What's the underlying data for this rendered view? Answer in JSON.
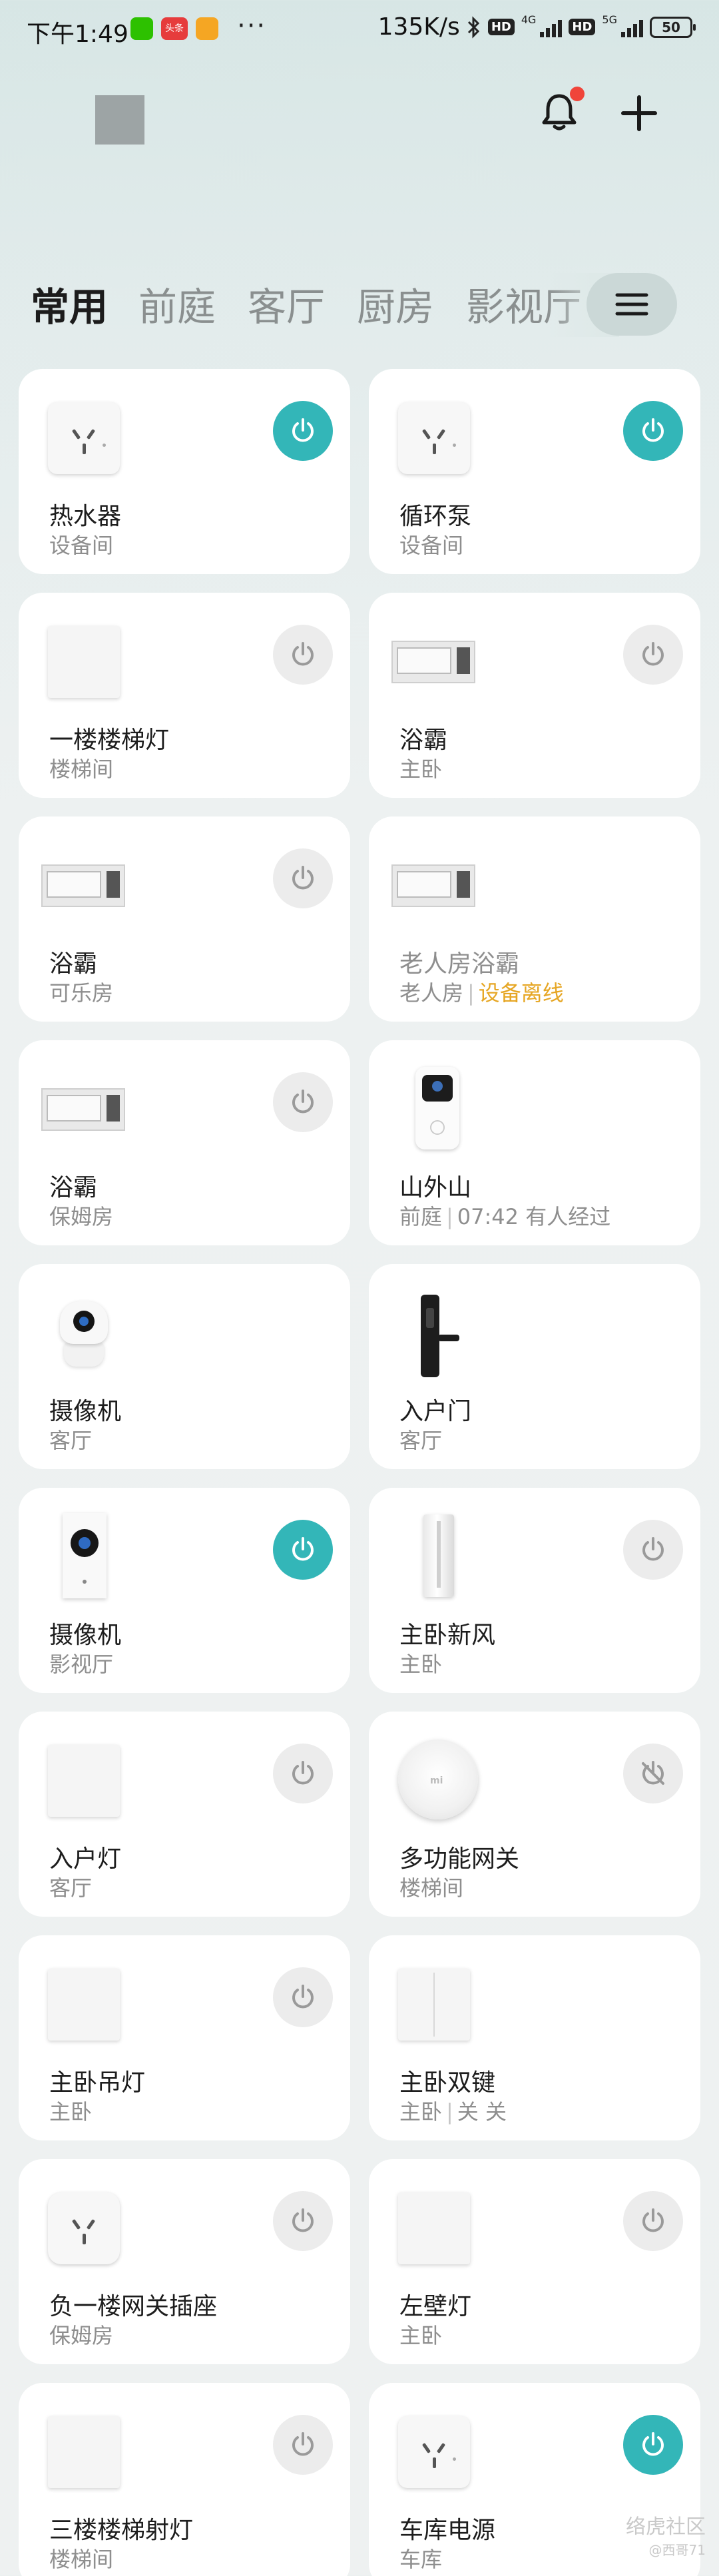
{
  "status_bar": {
    "time": "下午1:49",
    "app_badge": "头条",
    "more": "···",
    "net_speed": "135K/s",
    "hd1": "HD",
    "net1": "4G",
    "hd2": "HD",
    "net2": "5G",
    "battery": "50"
  },
  "header": {
    "bell_icon": "bell-icon",
    "add_icon": "plus-icon",
    "bell_badge_color": "#f0453a"
  },
  "tabs": [
    "常用",
    "前庭",
    "客厅",
    "厨房",
    "影视厅"
  ],
  "accent_color": "#33b6b8",
  "devices": [
    {
      "name": "热水器",
      "room": "设备间",
      "icon": "wall-socket",
      "power": "on"
    },
    {
      "name": "循环泵",
      "room": "设备间",
      "icon": "wall-socket",
      "power": "on"
    },
    {
      "name": "一楼楼梯灯",
      "room": "楼梯间",
      "icon": "switch-panel",
      "power": "off"
    },
    {
      "name": "浴霸",
      "room": "主卧",
      "icon": "bath-heater",
      "power": "off"
    },
    {
      "name": "浴霸",
      "room": "可乐房",
      "icon": "bath-heater",
      "power": "off"
    },
    {
      "name": "老人房浴霸",
      "room": "老人房",
      "status": "设备离线",
      "icon": "bath-heater",
      "power": "none"
    },
    {
      "name": "浴霸",
      "room": "保姆房",
      "icon": "bath-heater",
      "power": "off"
    },
    {
      "name": "山外山",
      "room": "前庭",
      "status": "07:42 有人经过",
      "icon": "video-doorbell",
      "power": "none"
    },
    {
      "name": "摄像机",
      "room": "客厅",
      "icon": "camera",
      "power": "none"
    },
    {
      "name": "入户门",
      "room": "客厅",
      "icon": "door-lock",
      "power": "none"
    },
    {
      "name": "摄像机",
      "room": "影视厅",
      "icon": "camera-tall",
      "power": "on"
    },
    {
      "name": "主卧新风",
      "room": "主卧",
      "icon": "air-purifier",
      "power": "off"
    },
    {
      "name": "入户灯",
      "room": "客厅",
      "icon": "switch-panel",
      "power": "off"
    },
    {
      "name": "多功能网关",
      "room": "楼梯间",
      "icon": "gateway",
      "power": "disabled"
    },
    {
      "name": "主卧吊灯",
      "room": "主卧",
      "icon": "switch-panel",
      "power": "off"
    },
    {
      "name": "主卧双键",
      "room": "主卧",
      "status": "关 关",
      "icon": "double-switch",
      "power": "none"
    },
    {
      "name": "负一楼网关插座",
      "room": "保姆房",
      "icon": "smart-plug",
      "power": "off"
    },
    {
      "name": "左壁灯",
      "room": "主卧",
      "icon": "switch-panel",
      "power": "off"
    },
    {
      "name": "三楼楼梯射灯",
      "room": "楼梯间",
      "icon": "switch-panel",
      "power": "off"
    },
    {
      "name": "车库电源",
      "room": "车库",
      "icon": "wall-socket",
      "power": "on"
    }
  ],
  "watermark": {
    "line1": "络虎社区",
    "line2": "@西哥71"
  }
}
